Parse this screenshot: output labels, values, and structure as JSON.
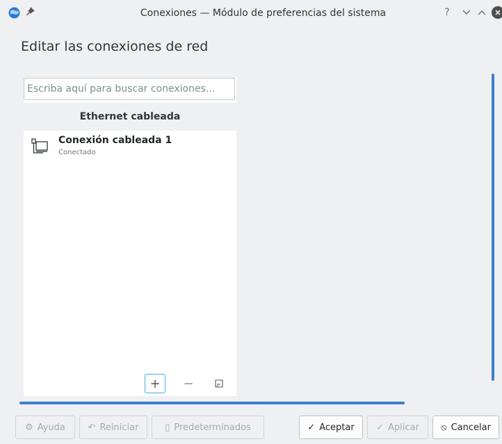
{
  "window": {
    "title": "Conexiones — Módulo de preferencias del sistema",
    "app_icon": "network-globe-icon",
    "pin_icon": "pin-icon",
    "controls": {
      "help": "?",
      "minimize": "⌄",
      "maximize": "⌃",
      "close": "✕"
    }
  },
  "page": {
    "heading": "Editar las conexiones de red"
  },
  "search": {
    "placeholder": "Escriba aquí para buscar conexiones...",
    "value": ""
  },
  "connections": {
    "group_header": "Ethernet cableada",
    "items": [
      {
        "name": "Conexión cableada 1",
        "status": "Conectado",
        "icon": "wired-network-icon"
      }
    ]
  },
  "list_toolbar": {
    "add": "+",
    "remove": "−",
    "export": "export-icon"
  },
  "buttons": {
    "help": {
      "label": "Ayuda",
      "icon": "⚙",
      "enabled": false
    },
    "reset": {
      "label": "Reiniciar",
      "icon": "↶",
      "enabled": false
    },
    "defaults": {
      "label": "Predeterminados",
      "icon": "▯",
      "enabled": false
    },
    "ok": {
      "label": "Aceptar",
      "icon": "✓",
      "enabled": true
    },
    "apply": {
      "label": "Aplicar",
      "icon": "✓",
      "enabled": false
    },
    "cancel": {
      "label": "Cancelar",
      "icon": "⦸",
      "enabled": true
    }
  },
  "colors": {
    "accent": "#3daee9",
    "scrollbar": "#3d7fcf",
    "background": "#eff0f1"
  }
}
